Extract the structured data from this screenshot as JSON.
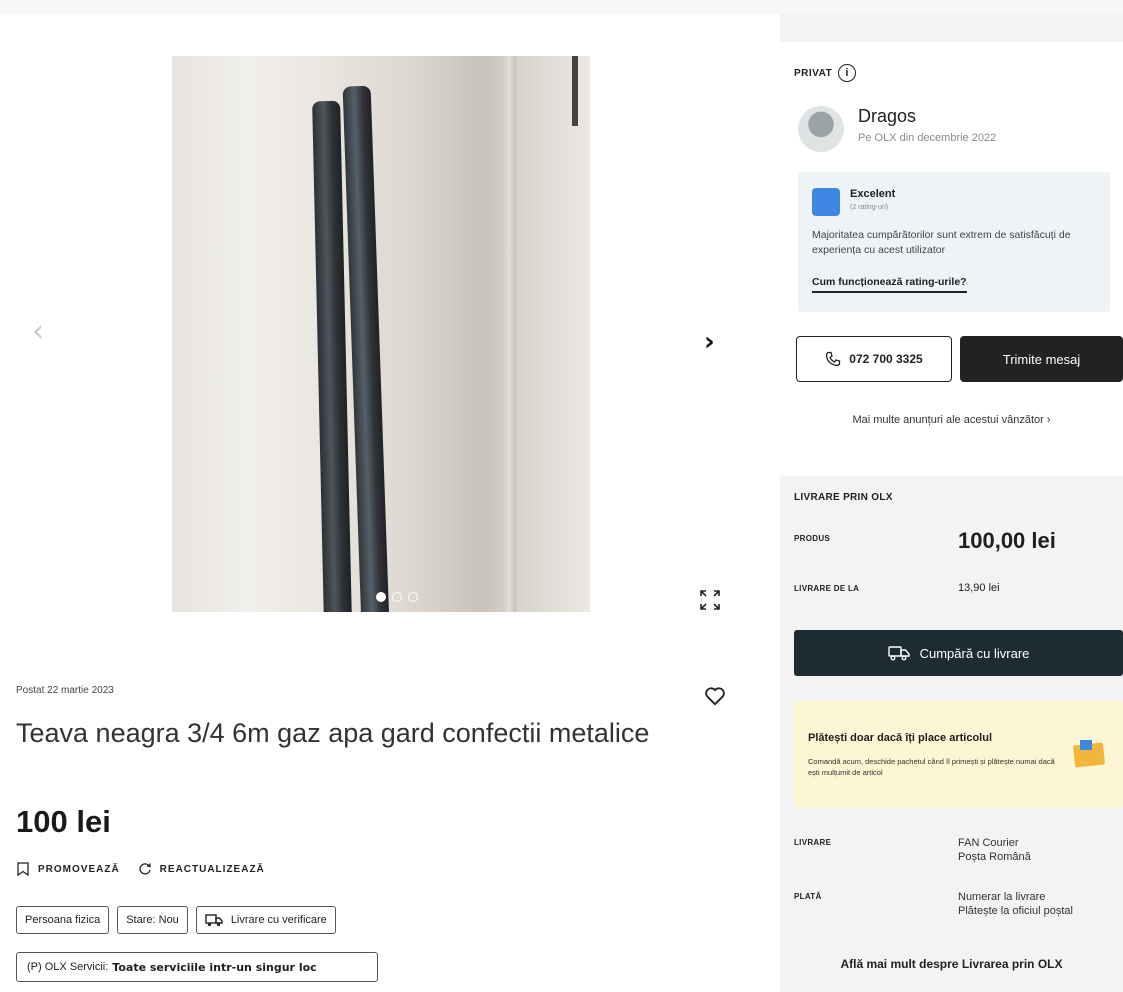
{
  "gallery": {
    "prev_arrow": "‹",
    "next_arrow": "›"
  },
  "listing": {
    "posted": "Postat 22 martie 2023",
    "title": "Teava neagra 3/4 6m gaz apa gard confectii metalice",
    "price": "100 lei",
    "actions": {
      "promote": "PROMOVEAZĂ",
      "refresh": "REACTUALIZEAZĂ"
    },
    "tags": [
      "Persoana fizica",
      "Stare: Nou",
      "Livrare cu verificare"
    ],
    "services_prefix": "(P) OLX Servicii:",
    "services_text": "Toate serviciile intr-un singur loc"
  },
  "seller": {
    "type": "PRIVAT",
    "name": "Dragos",
    "since": "Pe OLX din decembrie 2022",
    "rating": {
      "level": "Excelent",
      "count": "(2 rating-uri)",
      "description": "Majoritatea cumpărătorilor sunt extrem de satisfăcuți de experiența cu acest utilizator",
      "link": "Cum funcționează rating-urile?"
    },
    "phone": "072 700 3325",
    "message_label": "Trimite mesaj",
    "more_ads": "Mai multe anunțuri ale acestui vânzător"
  },
  "delivery": {
    "heading": "LIVRARE PRIN OLX",
    "product_label": "PRODUS",
    "product_price": "100,00 lei",
    "delivery_from_label": "LIVRARE DE LA",
    "delivery_from_value": "13,90 lei",
    "buy_label": "Cumpără cu livrare",
    "promo_title": "Plătești doar dacă îți place articolul",
    "promo_text": "Comandă acum, deschide pachetul când îl primești și plătește numai dacă ești mulțumit de articol",
    "courier_label": "LIVRARE",
    "courier_1": "FAN Courier",
    "courier_2": "Poșta Română",
    "payment_label": "PLATĂ",
    "payment_1": "Numerar la livrare",
    "payment_2": "Plătește la oficiul poștal",
    "learn_more": "Află mai mult despre Livrarea prin OLX"
  }
}
